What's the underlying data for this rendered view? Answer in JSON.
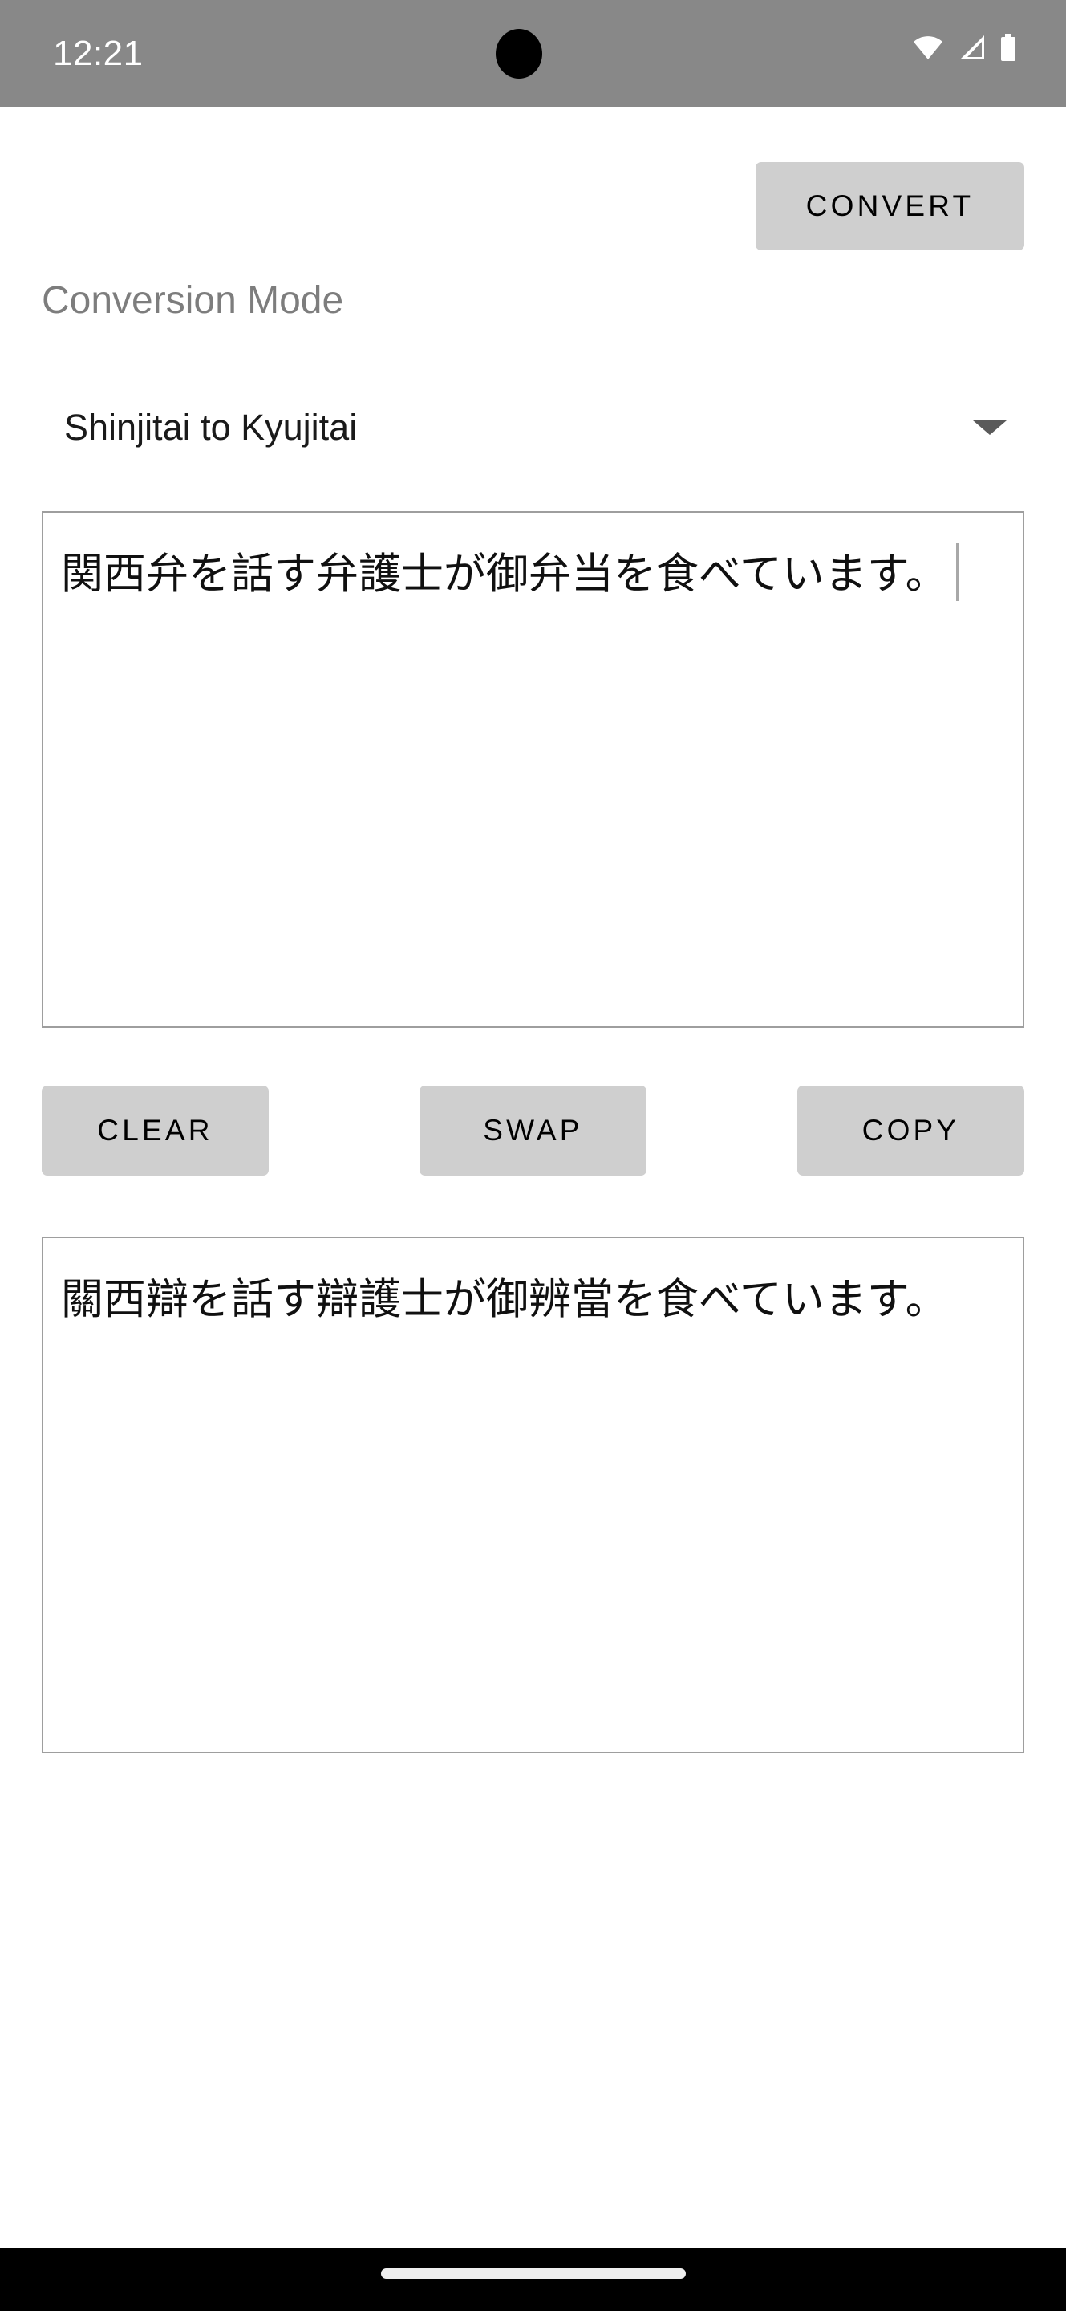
{
  "status_bar": {
    "time": "12:21",
    "icons": [
      "wifi-icon",
      "cellular-signal-icon",
      "battery-icon"
    ],
    "background_color": "#888888",
    "foreground_color": "#ffffff"
  },
  "toolbar": {
    "convert_label": "CONVERT"
  },
  "conversion_mode": {
    "label": "Conversion Mode",
    "selected_value": "Shinjitai to Kyujitai",
    "dropdown_icon": "chevron-down-icon"
  },
  "input": {
    "text": "関西弁を話す弁護士が御弁当を食べています。",
    "has_cursor": true
  },
  "output": {
    "text": "關西辯を話す辯護士が御辨當を食べています。"
  },
  "actions": {
    "clear_label": "CLEAR",
    "swap_label": "SWAP",
    "copy_label": "COPY"
  },
  "navigation": {
    "gesture_pill": "home-gesture-pill"
  },
  "colors": {
    "button_background": "#cfcfcf",
    "button_text": "#000000",
    "label_gray": "#7d7d7d",
    "border_gray": "#9e9e9e",
    "page_background": "#ffffff",
    "nav_background": "#000000"
  }
}
